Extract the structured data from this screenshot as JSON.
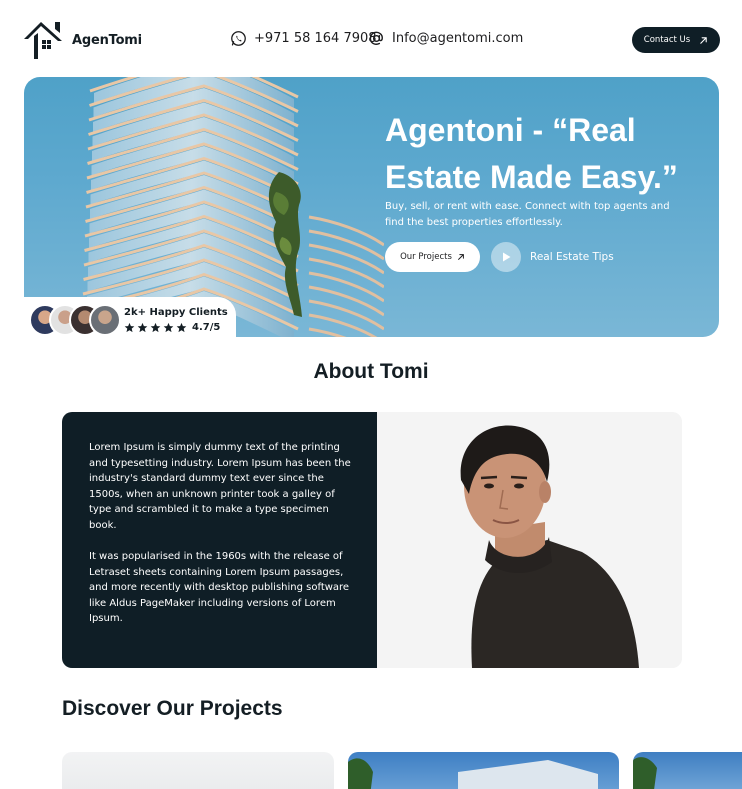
{
  "header": {
    "brand": "AgenTomi",
    "phone": "+971 58 164 7908",
    "email": "Info@agentomi.com",
    "contact_button": "Contact Us"
  },
  "hero": {
    "title": "Agentoni - “Real Estate Made Easy.”",
    "subtitle": "Buy, sell, or rent with ease. Connect with top agents and find the best properties effortlessly.",
    "projects_button": "Our Projects",
    "tips_label": "Real Estate Tips",
    "clients_label": "2k+ Happy Clients",
    "rating": "4.7/5",
    "stars": 5
  },
  "about": {
    "title": "About Tomi",
    "paragraph_1": "Lorem Ipsum is simply dummy text of the printing and typesetting industry. Lorem Ipsum has been the industry's standard dummy text ever since the 1500s, when an unknown printer took a galley of type and scrambled it to make a type specimen book.",
    "paragraph_2": "It was popularised in the 1960s with the release of Letraset sheets containing Lorem Ipsum passages, and more recently with desktop publishing software like Aldus PageMaker including versions of Lorem Ipsum."
  },
  "projects": {
    "title": "Discover Our Projects"
  },
  "colors": {
    "dark": "#0f1e26",
    "hero_sky": "#5ea9cf",
    "white": "#ffffff"
  },
  "icons": [
    "logo-house-icon",
    "whatsapp-icon",
    "at-sign-icon",
    "arrow-up-right-icon",
    "play-icon",
    "star-icon"
  ]
}
